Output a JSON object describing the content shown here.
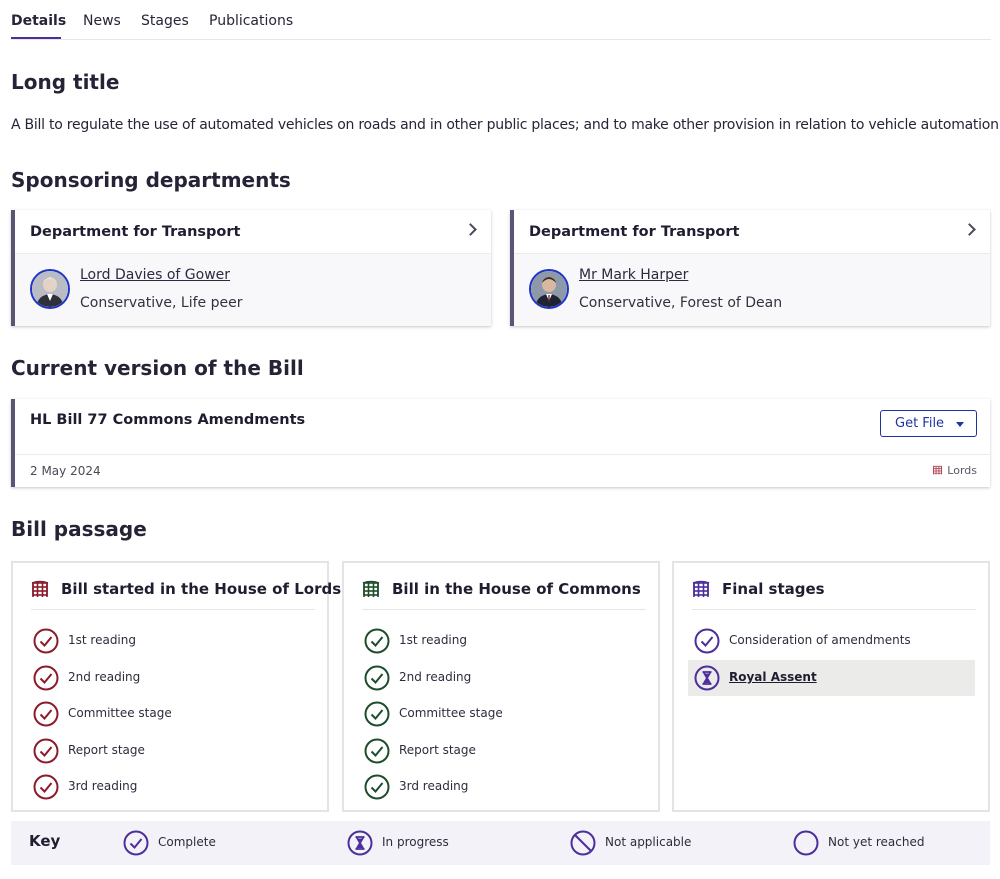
{
  "tabs": {
    "details": "Details",
    "news": "News",
    "stages": "Stages",
    "publications": "Publications"
  },
  "long_title": {
    "heading": "Long title",
    "text": "A Bill to regulate the use of automated vehicles on roads and in other public places; and to make other provision in relation to vehicle automation."
  },
  "sponsoring": {
    "heading": "Sponsoring departments",
    "departments": [
      {
        "name": "Department for Transport",
        "member": "Lord Davies of Gower",
        "party": "Conservative, Life peer"
      },
      {
        "name": "Department for Transport",
        "member": "Mr Mark Harper",
        "party": "Conservative, Forest of Dean"
      }
    ]
  },
  "current_version": {
    "heading": "Current version of the Bill",
    "title": "HL Bill 77 Commons Amendments",
    "get_file": "Get File",
    "date": "2 May 2024",
    "house": "Lords"
  },
  "bill_passage": {
    "heading": "Bill passage",
    "lords": {
      "title": "Bill started in the House of Lords",
      "stages": [
        "1st reading",
        "2nd reading",
        "Committee stage",
        "Report stage",
        "3rd reading"
      ]
    },
    "commons": {
      "title": "Bill in the House of Commons",
      "stages": [
        "1st reading",
        "2nd reading",
        "Committee stage",
        "Report stage",
        "3rd reading"
      ]
    },
    "final": {
      "title": "Final stages",
      "stages": [
        "Consideration of amendments",
        "Royal Assent"
      ]
    }
  },
  "key": {
    "title": "Key",
    "complete": "Complete",
    "in_progress": "In progress",
    "not_applicable": "Not applicable",
    "not_yet_reached": "Not yet reached"
  },
  "colors": {
    "lords": "#8a1c2b",
    "commons": "#1e4d2b",
    "final": "#4d2e9b",
    "accent": "#1f34a0"
  }
}
